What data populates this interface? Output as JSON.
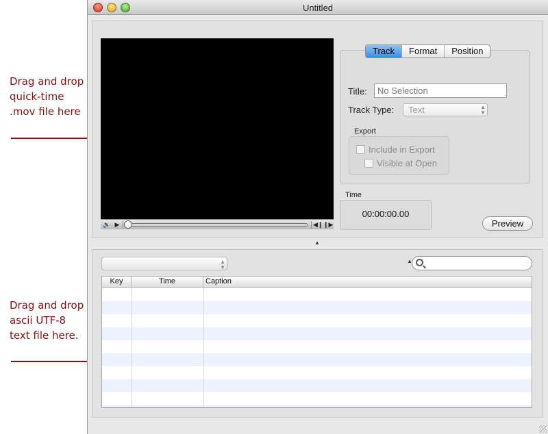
{
  "annotations": {
    "video_hint": "Drag and drop quick-time .mov file here",
    "text_hint": "Drag and drop ascii UTF-8 text file here."
  },
  "window": {
    "title": "Untitled"
  },
  "player": {
    "controls": {
      "volume_icon": "speaker-icon",
      "play_icon": "play-icon",
      "back_icon": "step-back-icon",
      "forward_icon": "step-forward-icon"
    }
  },
  "inspector": {
    "tabs": [
      {
        "label": "Track",
        "active": true
      },
      {
        "label": "Format",
        "active": false
      },
      {
        "label": "Position",
        "active": false
      }
    ],
    "title_label": "Title:",
    "title_placeholder": "No Selection",
    "track_type_label": "Track Type:",
    "track_type_value": "Text",
    "export_label": "Export",
    "include_in_export": "Include in Export",
    "visible_at_open": "Visible at Open",
    "time_label": "Time",
    "time_value": "00:00:00.00",
    "preview_label": "Preview"
  },
  "captions": {
    "popup_value": "",
    "search_value": "",
    "columns": [
      "Key",
      "Time",
      "Caption"
    ],
    "row_count": 10
  },
  "colors": {
    "annotation": "#8b0f0f",
    "active_tab": "#3b8fe4",
    "alt_row": "#edf3fe"
  }
}
